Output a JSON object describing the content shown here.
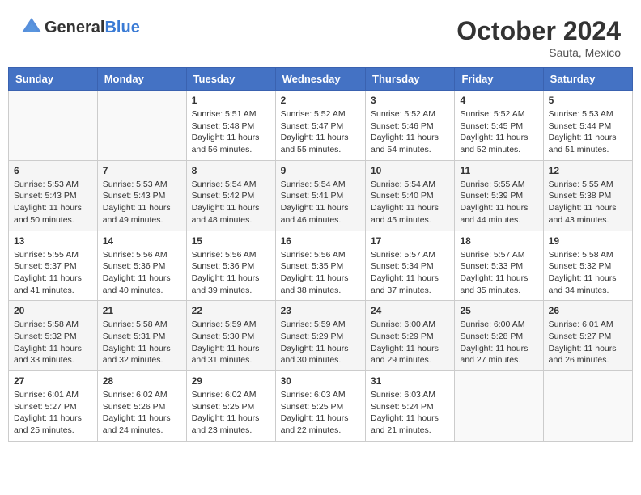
{
  "header": {
    "logo_general": "General",
    "logo_blue": "Blue",
    "month": "October 2024",
    "location": "Sauta, Mexico"
  },
  "days_of_week": [
    "Sunday",
    "Monday",
    "Tuesday",
    "Wednesday",
    "Thursday",
    "Friday",
    "Saturday"
  ],
  "weeks": [
    [
      {
        "day": "",
        "sunrise": "",
        "sunset": "",
        "daylight": ""
      },
      {
        "day": "",
        "sunrise": "",
        "sunset": "",
        "daylight": ""
      },
      {
        "day": "1",
        "sunrise": "Sunrise: 5:51 AM",
        "sunset": "Sunset: 5:48 PM",
        "daylight": "Daylight: 11 hours and 56 minutes."
      },
      {
        "day": "2",
        "sunrise": "Sunrise: 5:52 AM",
        "sunset": "Sunset: 5:47 PM",
        "daylight": "Daylight: 11 hours and 55 minutes."
      },
      {
        "day": "3",
        "sunrise": "Sunrise: 5:52 AM",
        "sunset": "Sunset: 5:46 PM",
        "daylight": "Daylight: 11 hours and 54 minutes."
      },
      {
        "day": "4",
        "sunrise": "Sunrise: 5:52 AM",
        "sunset": "Sunset: 5:45 PM",
        "daylight": "Daylight: 11 hours and 52 minutes."
      },
      {
        "day": "5",
        "sunrise": "Sunrise: 5:53 AM",
        "sunset": "Sunset: 5:44 PM",
        "daylight": "Daylight: 11 hours and 51 minutes."
      }
    ],
    [
      {
        "day": "6",
        "sunrise": "Sunrise: 5:53 AM",
        "sunset": "Sunset: 5:43 PM",
        "daylight": "Daylight: 11 hours and 50 minutes."
      },
      {
        "day": "7",
        "sunrise": "Sunrise: 5:53 AM",
        "sunset": "Sunset: 5:43 PM",
        "daylight": "Daylight: 11 hours and 49 minutes."
      },
      {
        "day": "8",
        "sunrise": "Sunrise: 5:54 AM",
        "sunset": "Sunset: 5:42 PM",
        "daylight": "Daylight: 11 hours and 48 minutes."
      },
      {
        "day": "9",
        "sunrise": "Sunrise: 5:54 AM",
        "sunset": "Sunset: 5:41 PM",
        "daylight": "Daylight: 11 hours and 46 minutes."
      },
      {
        "day": "10",
        "sunrise": "Sunrise: 5:54 AM",
        "sunset": "Sunset: 5:40 PM",
        "daylight": "Daylight: 11 hours and 45 minutes."
      },
      {
        "day": "11",
        "sunrise": "Sunrise: 5:55 AM",
        "sunset": "Sunset: 5:39 PM",
        "daylight": "Daylight: 11 hours and 44 minutes."
      },
      {
        "day": "12",
        "sunrise": "Sunrise: 5:55 AM",
        "sunset": "Sunset: 5:38 PM",
        "daylight": "Daylight: 11 hours and 43 minutes."
      }
    ],
    [
      {
        "day": "13",
        "sunrise": "Sunrise: 5:55 AM",
        "sunset": "Sunset: 5:37 PM",
        "daylight": "Daylight: 11 hours and 41 minutes."
      },
      {
        "day": "14",
        "sunrise": "Sunrise: 5:56 AM",
        "sunset": "Sunset: 5:36 PM",
        "daylight": "Daylight: 11 hours and 40 minutes."
      },
      {
        "day": "15",
        "sunrise": "Sunrise: 5:56 AM",
        "sunset": "Sunset: 5:36 PM",
        "daylight": "Daylight: 11 hours and 39 minutes."
      },
      {
        "day": "16",
        "sunrise": "Sunrise: 5:56 AM",
        "sunset": "Sunset: 5:35 PM",
        "daylight": "Daylight: 11 hours and 38 minutes."
      },
      {
        "day": "17",
        "sunrise": "Sunrise: 5:57 AM",
        "sunset": "Sunset: 5:34 PM",
        "daylight": "Daylight: 11 hours and 37 minutes."
      },
      {
        "day": "18",
        "sunrise": "Sunrise: 5:57 AM",
        "sunset": "Sunset: 5:33 PM",
        "daylight": "Daylight: 11 hours and 35 minutes."
      },
      {
        "day": "19",
        "sunrise": "Sunrise: 5:58 AM",
        "sunset": "Sunset: 5:32 PM",
        "daylight": "Daylight: 11 hours and 34 minutes."
      }
    ],
    [
      {
        "day": "20",
        "sunrise": "Sunrise: 5:58 AM",
        "sunset": "Sunset: 5:32 PM",
        "daylight": "Daylight: 11 hours and 33 minutes."
      },
      {
        "day": "21",
        "sunrise": "Sunrise: 5:58 AM",
        "sunset": "Sunset: 5:31 PM",
        "daylight": "Daylight: 11 hours and 32 minutes."
      },
      {
        "day": "22",
        "sunrise": "Sunrise: 5:59 AM",
        "sunset": "Sunset: 5:30 PM",
        "daylight": "Daylight: 11 hours and 31 minutes."
      },
      {
        "day": "23",
        "sunrise": "Sunrise: 5:59 AM",
        "sunset": "Sunset: 5:29 PM",
        "daylight": "Daylight: 11 hours and 30 minutes."
      },
      {
        "day": "24",
        "sunrise": "Sunrise: 6:00 AM",
        "sunset": "Sunset: 5:29 PM",
        "daylight": "Daylight: 11 hours and 29 minutes."
      },
      {
        "day": "25",
        "sunrise": "Sunrise: 6:00 AM",
        "sunset": "Sunset: 5:28 PM",
        "daylight": "Daylight: 11 hours and 27 minutes."
      },
      {
        "day": "26",
        "sunrise": "Sunrise: 6:01 AM",
        "sunset": "Sunset: 5:27 PM",
        "daylight": "Daylight: 11 hours and 26 minutes."
      }
    ],
    [
      {
        "day": "27",
        "sunrise": "Sunrise: 6:01 AM",
        "sunset": "Sunset: 5:27 PM",
        "daylight": "Daylight: 11 hours and 25 minutes."
      },
      {
        "day": "28",
        "sunrise": "Sunrise: 6:02 AM",
        "sunset": "Sunset: 5:26 PM",
        "daylight": "Daylight: 11 hours and 24 minutes."
      },
      {
        "day": "29",
        "sunrise": "Sunrise: 6:02 AM",
        "sunset": "Sunset: 5:25 PM",
        "daylight": "Daylight: 11 hours and 23 minutes."
      },
      {
        "day": "30",
        "sunrise": "Sunrise: 6:03 AM",
        "sunset": "Sunset: 5:25 PM",
        "daylight": "Daylight: 11 hours and 22 minutes."
      },
      {
        "day": "31",
        "sunrise": "Sunrise: 6:03 AM",
        "sunset": "Sunset: 5:24 PM",
        "daylight": "Daylight: 11 hours and 21 minutes."
      },
      {
        "day": "",
        "sunrise": "",
        "sunset": "",
        "daylight": ""
      },
      {
        "day": "",
        "sunrise": "",
        "sunset": "",
        "daylight": ""
      }
    ]
  ]
}
